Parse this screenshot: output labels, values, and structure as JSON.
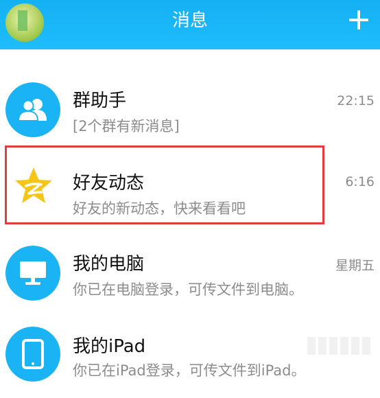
{
  "header": {
    "title": "消息",
    "add_icon": "plus-icon",
    "avatar_icon": "user-avatar"
  },
  "conversations": [
    {
      "name": "群助手",
      "preview": "[2个群有新消息]",
      "time": "22:15",
      "icon": "group-people-icon"
    },
    {
      "name": "好友动态",
      "preview": "好友的新动态，快来看看吧",
      "time": "6:16",
      "icon": "qzone-star-icon",
      "highlighted": true
    },
    {
      "name": "我的电脑",
      "preview": "你已在电脑登录，可传文件到电脑。",
      "time": "星期五",
      "icon": "monitor-icon"
    },
    {
      "name": "我的iPad",
      "preview": "你已在iPad登录，可传文件到iPad。",
      "time": "",
      "icon": "tablet-icon"
    }
  ],
  "colors": {
    "header_bg": "#1ab3f4",
    "icon_bg": "#1ab3f4",
    "highlight_border": "#e53b3b",
    "qzone_star": "#f5c518"
  }
}
